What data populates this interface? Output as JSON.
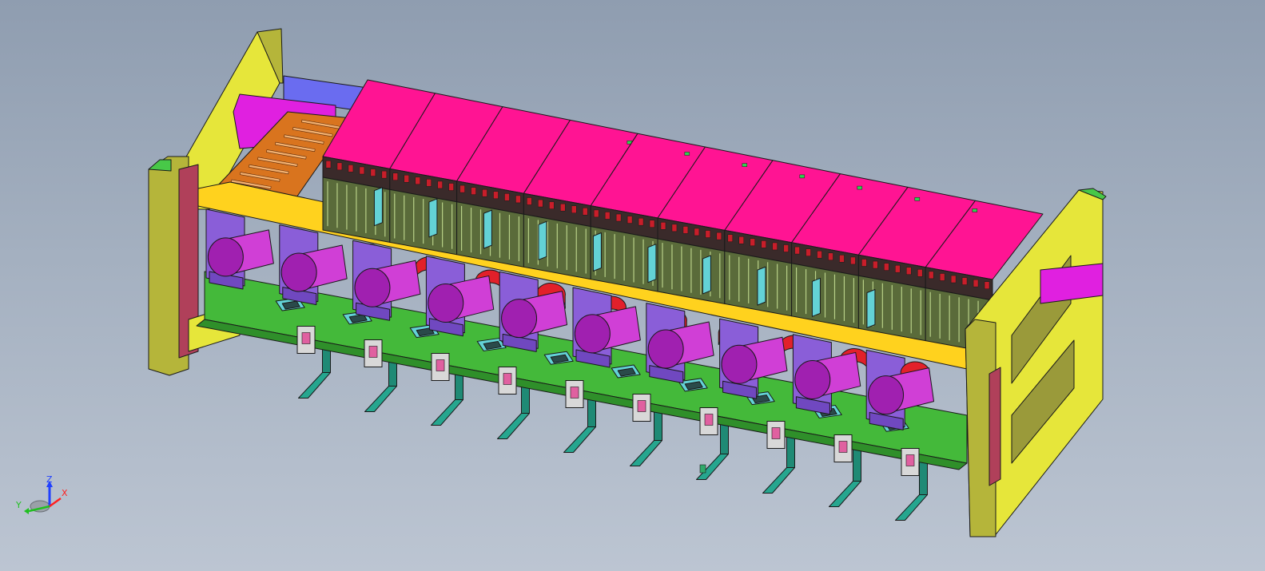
{
  "window": {
    "title": ""
  },
  "scene": {
    "model": "rack-assembly",
    "module_count": 10,
    "colors": {
      "frame_yellow": "#e6e63a",
      "frame_olive": "#b5b53a",
      "cover_magenta": "#ff1493",
      "cover_side": "#e01080",
      "rail_yellow": "#ffd21e",
      "base_green": "#44b93a",
      "base_green_dark": "#2f8f2a",
      "capacitor_purple": "#d03fd6",
      "capacitor_cap": "#a020b0",
      "bracket_violet": "#8a5ed8",
      "terminal_orange": "#d9741e",
      "foot_teal": "#26a68f",
      "clamp_cyan": "#63d2d6",
      "fan_red": "#e2202a",
      "board_dark": "#5a6b3a",
      "connector_red": "#c81e2a",
      "panel_blue": "#6a6cf0"
    }
  },
  "triad": {
    "z_label": "Z",
    "x_label": "X",
    "y_label": "Y",
    "z_color": "#2040ff",
    "x_color": "#ff2020",
    "y_color": "#20c020"
  }
}
